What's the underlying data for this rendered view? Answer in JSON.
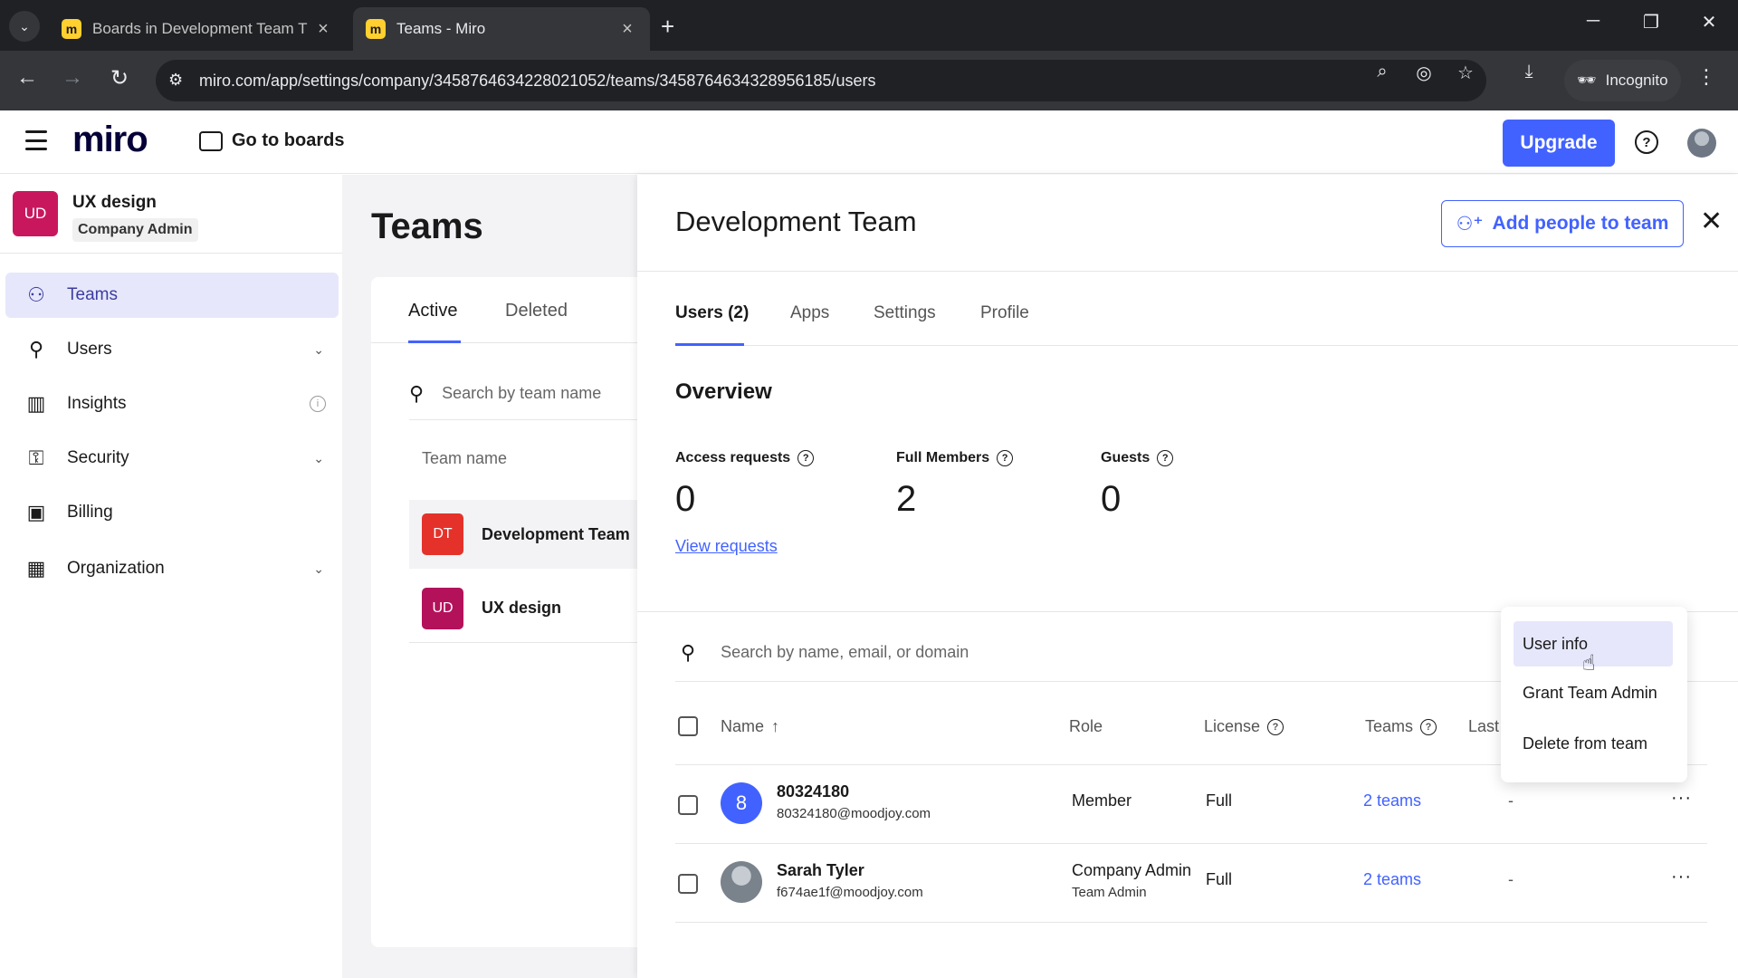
{
  "browser": {
    "tabs": [
      {
        "title": "Boards in Development Team T",
        "active": false
      },
      {
        "title": "Teams - Miro",
        "active": true
      }
    ],
    "url": "miro.com/app/settings/company/3458764634228021052/teams/3458764634328956185/users",
    "profile_label": "Incognito"
  },
  "header": {
    "logo": "miro",
    "goto_boards": "Go to boards",
    "upgrade": "Upgrade"
  },
  "sidebar": {
    "org_badge": "UD",
    "org_name": "UX design",
    "org_role": "Company Admin",
    "items": [
      {
        "label": "Teams",
        "icon": "users-icon",
        "active": true
      },
      {
        "label": "Users",
        "icon": "user-icon"
      },
      {
        "label": "Insights",
        "icon": "bar-chart-icon"
      },
      {
        "label": "Security",
        "icon": "key-icon"
      },
      {
        "label": "Billing",
        "icon": "wallet-icon"
      },
      {
        "label": "Organization",
        "icon": "building-icon"
      }
    ]
  },
  "teams_panel": {
    "title": "Teams",
    "tabs": [
      "Active",
      "Deleted"
    ],
    "search_placeholder": "Search by team name",
    "column": "Team name",
    "teams": [
      {
        "badge": "DT",
        "name": "Development Team",
        "color": "#e4322b"
      },
      {
        "badge": "UD",
        "name": "UX design",
        "color": "#b3125b"
      }
    ]
  },
  "detail": {
    "title": "Development Team",
    "add_people": "Add people to team",
    "tabs": [
      "Users (2)",
      "Apps",
      "Settings",
      "Profile"
    ],
    "overview": "Overview",
    "stats": [
      {
        "label": "Access requests",
        "value": "0"
      },
      {
        "label": "Full Members",
        "value": "2"
      },
      {
        "label": "Guests",
        "value": "0"
      }
    ],
    "view_requests": "View requests",
    "search_placeholder": "Search by name, email, or domain",
    "columns": {
      "name": "Name",
      "sort": "↑",
      "role": "Role",
      "license": "License",
      "teams": "Teams",
      "last": "Last"
    },
    "users": [
      {
        "avatar": "8",
        "name": "80324180",
        "email": "80324180@moodjoy.com",
        "role": "Member",
        "role_sub": "",
        "license": "Full",
        "teams": "2 teams",
        "last": "-"
      },
      {
        "avatar": "",
        "name": "Sarah Tyler",
        "email": "f674ae1f@moodjoy.com",
        "role": "Company Admin",
        "role_sub": "Team Admin",
        "license": "Full",
        "teams": "2 teams",
        "last": "-"
      }
    ]
  },
  "context_menu": {
    "items": [
      "User info",
      "Grant Team Admin",
      "Delete from team"
    ]
  },
  "colors": {
    "accent": "#4262ff",
    "active_bg": "#e6e7fb"
  }
}
